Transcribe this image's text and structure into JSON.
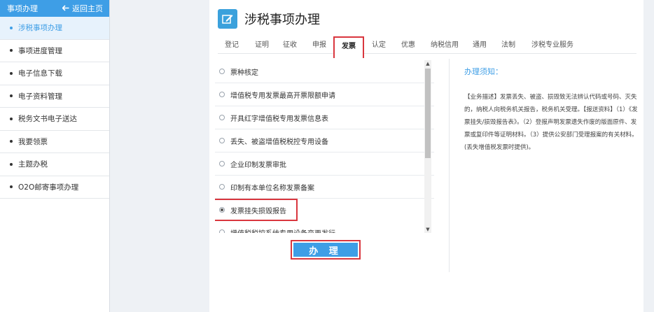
{
  "sidebar": {
    "header_title": "事项办理",
    "back_label": "返回主页",
    "items": [
      {
        "label": "涉税事项办理"
      },
      {
        "label": "事项进度管理"
      },
      {
        "label": "电子信息下载"
      },
      {
        "label": "电子资料管理"
      },
      {
        "label": "税务文书电子送达"
      },
      {
        "label": "我要领票"
      },
      {
        "label": "主题办税"
      },
      {
        "label": "O2O邮寄事项办理"
      }
    ],
    "active_index": 0
  },
  "main": {
    "title": "涉税事项办理",
    "tabs": [
      "登记",
      "证明",
      "征收",
      "申报",
      "发票",
      "认定",
      "优惠",
      "纳税信用",
      "通用",
      "法制",
      "涉税专业服务"
    ],
    "active_tab": "发票",
    "options": [
      {
        "label": "票种核定",
        "checked": false
      },
      {
        "label": "增值税专用发票最高开票限额申请",
        "checked": false
      },
      {
        "label": "开具红字增值税专用发票信息表",
        "checked": false
      },
      {
        "label": "丢失、被盗增值税税控专用设备",
        "checked": false
      },
      {
        "label": "企业印制发票审批",
        "checked": false
      },
      {
        "label": "印制有本单位名称发票备案",
        "checked": false
      },
      {
        "label": "发票挂失损毁报告",
        "checked": true
      },
      {
        "label": "增值税税控系统专用设备变更发行",
        "checked": false
      }
    ],
    "submit_label": "办 理"
  },
  "notice": {
    "title": "办理须知：",
    "body": "【业务描述】发票丢失、被盗、损毁致无法辨认代码或号码、灭失的，纳税人向税务机关报告，税务机关受理。【报送资料】（1）《发票挂失/损毁报告表》。（2）登报声明发票遗失作废的版面原件、发票或复印件等证明材料。（3）提供公安部门受理报案的有关材料。(丢失增值税发票时提供)。"
  },
  "colors": {
    "accent": "#3e9ee6",
    "highlight": "#d9363e"
  }
}
